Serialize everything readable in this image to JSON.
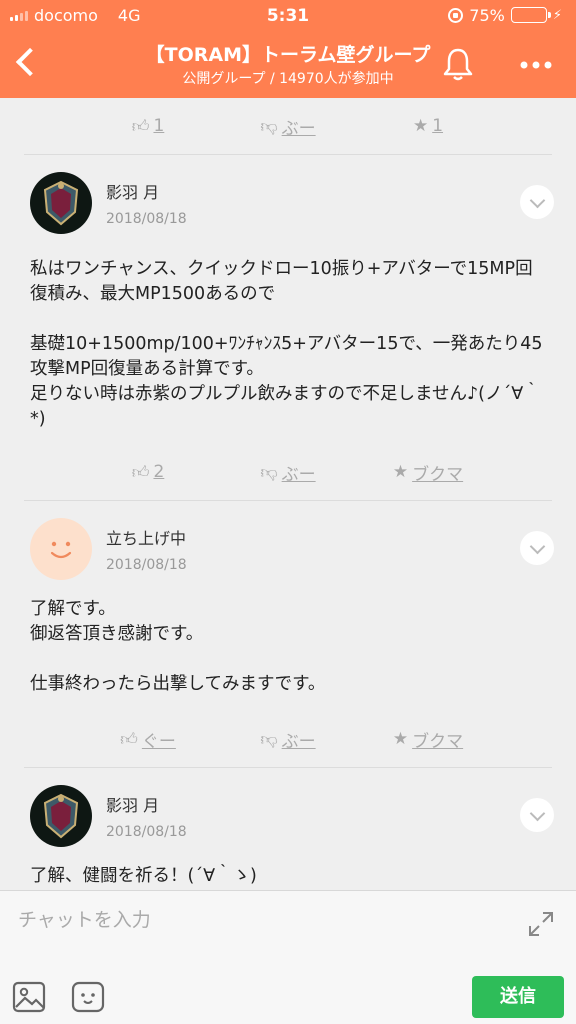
{
  "status": {
    "carrier": "docomo",
    "network": "4G",
    "time": "5:31",
    "battery": "75%",
    "battery_level": 0.75
  },
  "header": {
    "title": "【TORAM】トーラム壁グループ",
    "subtitle": "公開グループ / 14970人が参加中"
  },
  "top_reactions": {
    "like": "1",
    "boo": "ぶー",
    "fav": "1"
  },
  "posts": [
    {
      "name": "影羽 月",
      "date": "2018/08/18",
      "body": "私はワンチャンス、クイックドロー10振り+アバターで15MP回復積み、最大MP1500あるので\n\n基礎10+1500mp/100+ﾜﾝﾁｬﾝｽ5+アバター15で、一発あたり45攻撃MP回復量ある計算です。\n足りない時は赤紫のプルプル飲みますので不足しません♪(ノ´∀｀*)",
      "reactions": {
        "like": "2",
        "boo": "ぶー",
        "fav": "ブクマ"
      }
    },
    {
      "name": "立ち上げ中",
      "date": "2018/08/18",
      "body": "了解です。\n御返答頂き感謝です。\n\n仕事終わったら出撃してみますです。",
      "reactions": {
        "like": "ぐー",
        "boo": "ぶー",
        "fav": "ブクマ"
      }
    },
    {
      "name": "影羽 月",
      "date": "2018/08/18",
      "body": "了解、健闘を祈る！(´∀｀ゝ)"
    }
  ],
  "composer": {
    "placeholder": "チャットを入力",
    "send_label": "送信"
  },
  "colors": {
    "header": "#ff7f50",
    "send": "#2ebd59"
  }
}
